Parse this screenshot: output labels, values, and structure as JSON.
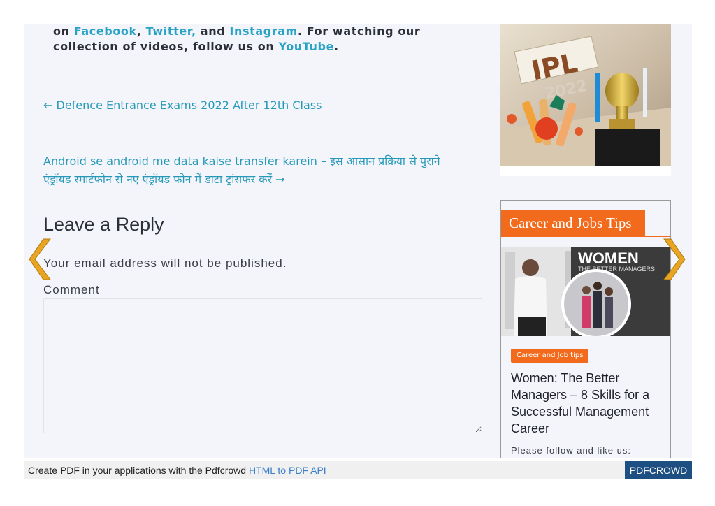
{
  "social": {
    "prefix": "on ",
    "facebook": "Facebook",
    "sep1": ", ",
    "twitter": "Twitter,",
    "and": " and ",
    "instagram": "Instagram",
    "middle": ". For watching our collection of videos, follow us on ",
    "youtube": "YouTube",
    "suffix": "."
  },
  "post_nav": {
    "previous": "← Defence Entrance Exams 2022 After 12th Class",
    "next": "Android se android me data kaise transfer karein – इस आसान प्रक्रिया से पुराने एंड्रॉयड स्मार्टफोन से नए एंड्रॉयड फोन में डाटा ट्रांसफर करें →"
  },
  "reply": {
    "title": "Leave a Reply",
    "notice": "Your email address will not be published.",
    "comment_label": "Comment",
    "comment_value": ""
  },
  "sidebar": {
    "ipl_image_text": {
      "title": "IPL",
      "year": "2022"
    },
    "career_widget": {
      "header": "Career and Jobs Tips",
      "image_text": {
        "headline": "WOMEN",
        "subline": "THE BETTER MANAGERS"
      },
      "category": "Career and Job tips",
      "post_title": "Women: The Better Managers – 8 Skills for a Successful Management Career",
      "follow": "Please follow and like us:"
    }
  },
  "pdf_bar": {
    "text": "Create PDF in your applications with the Pdfcrowd ",
    "link": "HTML to PDF API",
    "button": "PDFCROWD"
  },
  "colors": {
    "accent_orange": "#f26a1b",
    "link_blue": "#29a3c5",
    "arrow_gold": "#e7a521",
    "pdf_button": "#1d4f82"
  },
  "icons": [
    "chevron-left-icon",
    "chevron-right-icon"
  ]
}
